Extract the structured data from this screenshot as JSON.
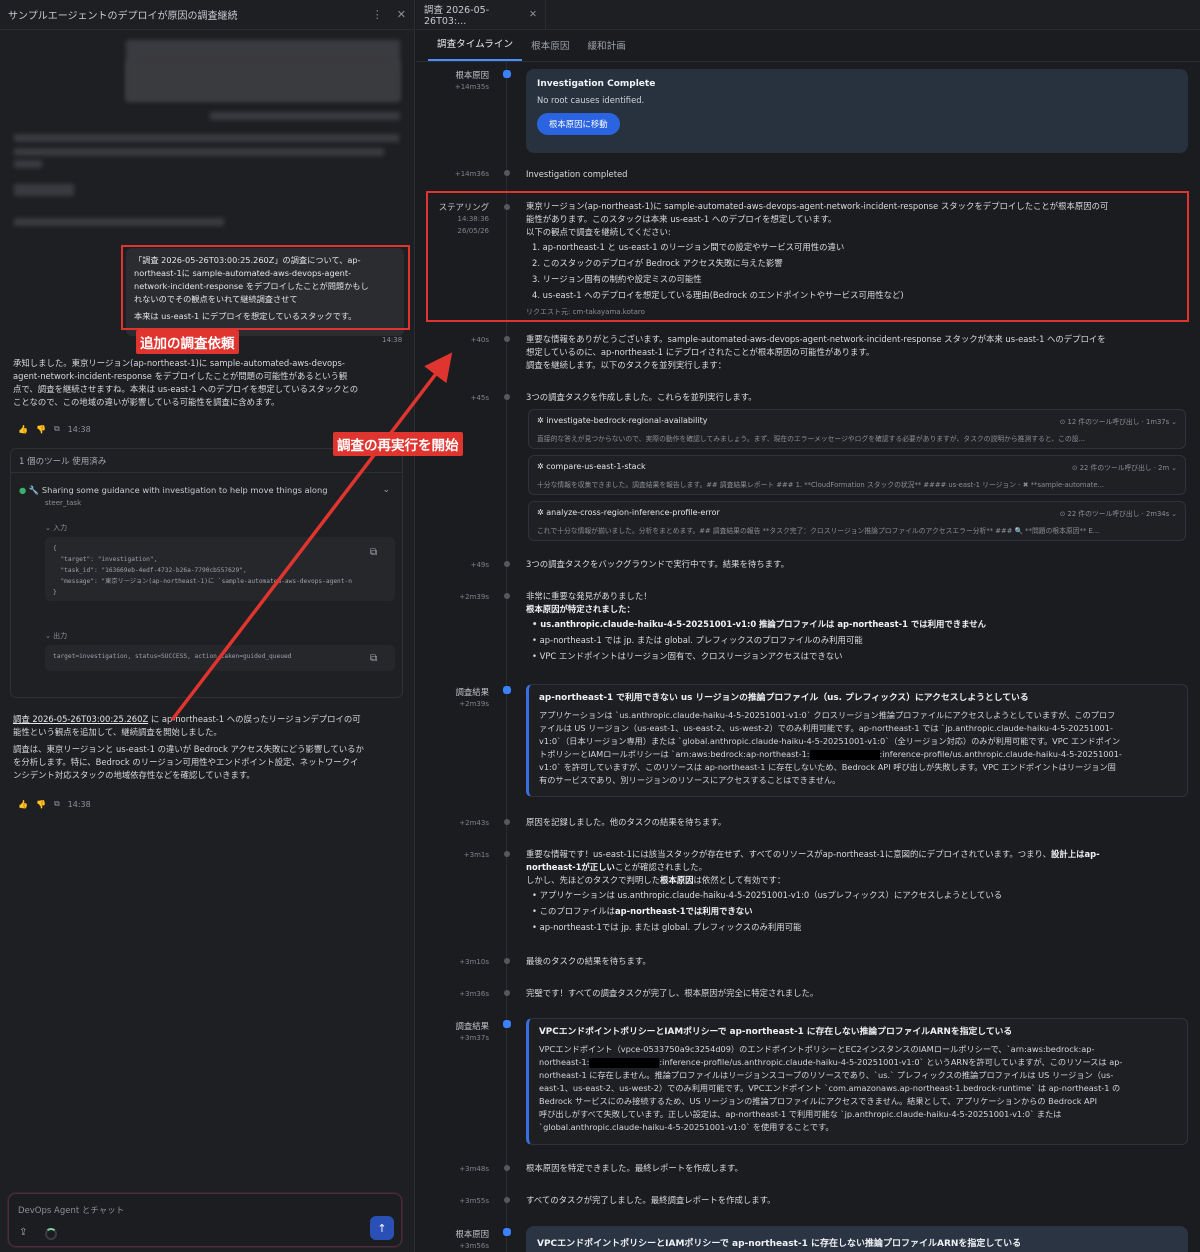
{
  "left": {
    "title": "サンプルエージェントのデプロイが原因の調査継続",
    "menu_icon": "⋮",
    "close_icon": "✕",
    "user_msg": {
      "line1": "「調査 2026-05-26T03:00:25.260Z」の調査について、ap-",
      "line2": "northeast-1に sample-automated-aws-devops-agent-",
      "line3": "network-incident-response をデプロイしたことが問題かもし",
      "line4": "れないのでその観点をいれて継続調査させて",
      "line5": "本来は us-east-1 にデプロイを想定しているスタックです。",
      "time": "14:38"
    },
    "label_request": "追加の調査依頼",
    "label_rerun": "調査の再実行を開始",
    "reply1": {
      "l1": "承知しました。東京リージョン(ap-northeast-1)に sample-automated-aws-devops-",
      "l2": "agent-network-incident-response をデプロイしたことが問題の可能性があるという観",
      "l3": "点で、調査を継続させますね。本来は us-east-1 へのデプロイを想定しているスタックとの",
      "l4": "ことなので、この地域の違いが影響している可能性を調査に含めます。",
      "time": "14:38"
    },
    "tool": {
      "header": "1 個のツール 使用済み",
      "name": "Sharing some guidance with investigation to help move things along",
      "sub": "steer_task",
      "input_label": "入力",
      "input_code": "{\n  \"target\": \"investigation\",\n  \"task_id\": \"163669eb-4edf-4732-b26a-7790cb557629\",\n  \"message\": \"東京リージョン(ap-northeast-1)に `sample-automated-aws-devops-agent-n\n}",
      "output_label": "出力",
      "output_code": "target=investigation, status=SUCCESS, action_taken=guided_queued"
    },
    "reply2": {
      "link": "調査 2026-05-26T03:00:25.260Z",
      "l1": " に ap-northeast-1 への誤ったリージョンデプロイの可",
      "l2": "能性という観点を追加して、継続調査を開始しました。",
      "l3": "調査は、東京リージョンと us-east-1 の違いが Bedrock アクセス失敗にどう影響しているか",
      "l4": "を分析します。特に、Bedrock のリージョン可用性やエンドポイント設定、ネットワークイ",
      "l5": "ンシデント対応スタックの地域依存性などを確認していきます。",
      "time": "14:38"
    },
    "chat_placeholder": "DevOps Agent とチャット"
  },
  "right": {
    "tab_title": "調査 2026-05-26T03:...",
    "subtabs": [
      "調査タイムライン",
      "根本原因",
      "緩和計画"
    ],
    "entries": {
      "e1": {
        "label": "根本原因",
        "time": "+14m35s",
        "title": "Investigation Complete",
        "body": "No root causes identified.",
        "button": "根本原因に移動"
      },
      "e2": {
        "time": "+14m36s",
        "text": "Investigation completed"
      },
      "e3": {
        "label": "ステアリング",
        "time": "14:38:36",
        "date": "26/05/26",
        "l1": "東京リージョン(ap-northeast-1)に sample-automated-aws-devops-agent-network-incident-response スタックをデプロイしたことが根本原因の可",
        "l2": "能性があります。このスタックは本来 us-east-1 へのデプロイを想定しています。",
        "l3": "以下の観点で調査を継続してください:",
        "items": [
          "1. ap-northeast-1 と us-east-1 のリージョン間での設定やサービス可用性の違い",
          "2. このスタックのデプロイが Bedrock アクセス失敗に与えた影響",
          "3. リージョン固有の制約や設定ミスの可能性",
          "4. us-east-1 へのデプロイを想定している理由(Bedrock のエンドポイントやサービス可用性など)"
        ],
        "requester": "リクエスト元: cm-takayama.kotaro"
      },
      "e4": {
        "time": "+40s",
        "l1": "重要な情報をありがとうございます。sample-automated-aws-devops-agent-network-incident-response スタックが本来 us-east-1 へのデプロイを",
        "l2": "想定しているのに、ap-northeast-1 にデプロイされたことが根本原因の可能性があります。",
        "l3": "調査を継続します。以下のタスクを並列実行します："
      },
      "e5": {
        "time": "+45s",
        "text": "3つの調査タスクを作成しました。これらを並列実行します。"
      },
      "tasks": [
        {
          "name": "investigate-bedrock-regional-availability",
          "meta": "12 件のツール呼び出し · 1m37s",
          "desc": "直接的な答えが見つからないので、実際の動作を確認してみましょう。まず、現在のエラーメッセージやログを確認する必要がありますが、タスクの説明から推測すると、この設..."
        },
        {
          "name": "compare-us-east-1-stack",
          "meta": "22 件のツール呼び出し · 2m",
          "desc": "十分な情報を収集できました。調査結果を報告します。## 調査結果レポート ### 1. **CloudFormation スタックの状況** #### us-east-1 リージョン - ✖ **sample-automate..."
        },
        {
          "name": "analyze-cross-region-inference-profile-error",
          "meta": "22 件のツール呼び出し · 2m34s",
          "desc": "これで十分な情報が揃いました。分析をまとめます。## 調査結果の報告 **タスク完了：クロスリージョン推論プロファイルのアクセスエラー分析** ### 🔍 **問題の根本原因** E..."
        }
      ],
      "e6": {
        "time": "+49s",
        "text": "3つの調査タスクをバックグラウンドで実行中です。結果を待ちます。"
      },
      "e7": {
        "time": "+2m39s",
        "l1": "非常に重要な発見がありました！",
        "l2": "根本原因が特定されました：",
        "b1": "us.anthropic.claude-haiku-4-5-20251001-v1:0 推論プロファイルは ap-northeast-1 では利用できません",
        "b2": "ap-northeast-1 では jp. または global. プレフィックスのプロファイルのみ利用可能",
        "b3": "VPC エンドポイントはリージョン固有で、クロスリージョンアクセスはできない"
      },
      "e8": {
        "label": "調査結果",
        "time": "+2m39s",
        "title": "ap-northeast-1 で利用できない us リージョンの推論プロファイル（us. プレフィックス）にアクセスしようとしている",
        "l1": "アプリケーションは `us.anthropic.claude-haiku-4-5-20251001-v1:0` クロスリージョン推論プロファイルにアクセスしようとしていますが、このプロフ",
        "l2": "ァイルは US リージョン（us-east-1、us-east-2、us-west-2）でのみ利用可能です。ap-northeast-1 では `jp.anthropic.claude-haiku-4-5-20251001-",
        "l3": "v1:0`（日本リージョン専用）または `global.anthropic.claude-haiku-4-5-20251001-v1:0`（全リージョン対応）のみが利用可能です。VPC エンドポイン",
        "l4a": "トポリシーとIAMロールポリシーは `arn:aws:bedrock:ap-northeast-1:",
        "l4b": ":inference-profile/us.anthropic.claude-haiku-4-5-20251001-",
        "l5": "v1:0` を許可していますが、このリソースは ap-northeast-1 に存在しないため、Bedrock API 呼び出しが失敗します。VPC エンドポイントはリージョン固",
        "l6": "有のサービスであり、別リージョンのリソースにアクセスすることはできません。"
      },
      "e9": {
        "time": "+2m43s",
        "text": "原因を記録しました。他のタスクの結果を待ちます。"
      },
      "e10": {
        "time": "+3m1s",
        "l1a": "重要な情報です！us-east-1には該当スタックが存在せず、すべてのリソースがap-northeast-1に意図的にデプロイされています。つまり、",
        "l1b": "設計上はap-",
        "l2a": "northeast-1が正しい",
        "l2b": "ことが確認されました。",
        "l3a": "しかし、先ほどのタスクで判明した",
        "l3b": "根本原因",
        "l3c": "は依然として有効です：",
        "b1": "アプリケーションは us.anthropic.claude-haiku-4-5-20251001-v1:0（usプレフィックス）にアクセスしようとしている",
        "b2a": "このプロファイルは",
        "b2b": "ap-northeast-1では利用できない",
        "b3": "ap-northeast-1では jp. または global. プレフィックスのみ利用可能"
      },
      "e11": {
        "time": "+3m10s",
        "text": "最後のタスクの結果を待ちます。"
      },
      "e12": {
        "time": "+3m36s",
        "text": "完璧です！すべての調査タスクが完了し、根本原因が完全に特定されました。"
      },
      "e13": {
        "label": "調査結果",
        "time": "+3m37s",
        "title": "VPCエンドポイントポリシーとIAMポリシーで ap-northeast-1 に存在しない推論プロファイルARNを指定している",
        "l1": "VPCエンドポイント（vpce-0533750a9c3254d09）のエンドポイントポリシーとEC2インスタンスのIAMロールポリシーで、`arn:aws:bedrock:ap-",
        "l2a": "northeast-1:",
        "l2b": ":inference-profile/us.anthropic.claude-haiku-4-5-20251001-v1:0` というARNを許可していますが、このリソースは ap-",
        "l3": "northeast-1 に存在しません。推論プロファイルはリージョンスコープのリソースであり、`us.` プレフィックスの推論プロファイルは US リージョン（us-",
        "l4": "east-1、us-east-2、us-west-2）でのみ利用可能です。VPCエンドポイント `com.amazonaws.ap-northeast-1.bedrock-runtime` は ap-northeast-1 の",
        "l5": "Bedrock サービスにのみ接続するため、US リージョンの推論プロファイルにアクセスできません。結果として、アプリケーションからの Bedrock API",
        "l6": "呼び出しがすべて失敗しています。正しい設定は、ap-northeast-1 で利用可能な `jp.anthropic.claude-haiku-4-5-20251001-v1:0` または",
        "l7": "`global.anthropic.claude-haiku-4-5-20251001-v1:0` を使用することです。"
      },
      "e14": {
        "time": "+3m48s",
        "text": "根本原因を特定できました。最終レポートを作成します。"
      },
      "e15": {
        "time": "+3m55s",
        "text": "すべてのタスクが完了しました。最終調査レポートを作成します。"
      },
      "e16": {
        "label": "根本原因",
        "time": "+3m56s",
        "title": "VPCエンドポイントポリシーとIAMポリシーで ap-northeast-1 に存在しない推論プロファイルARNを指定している"
      }
    }
  }
}
